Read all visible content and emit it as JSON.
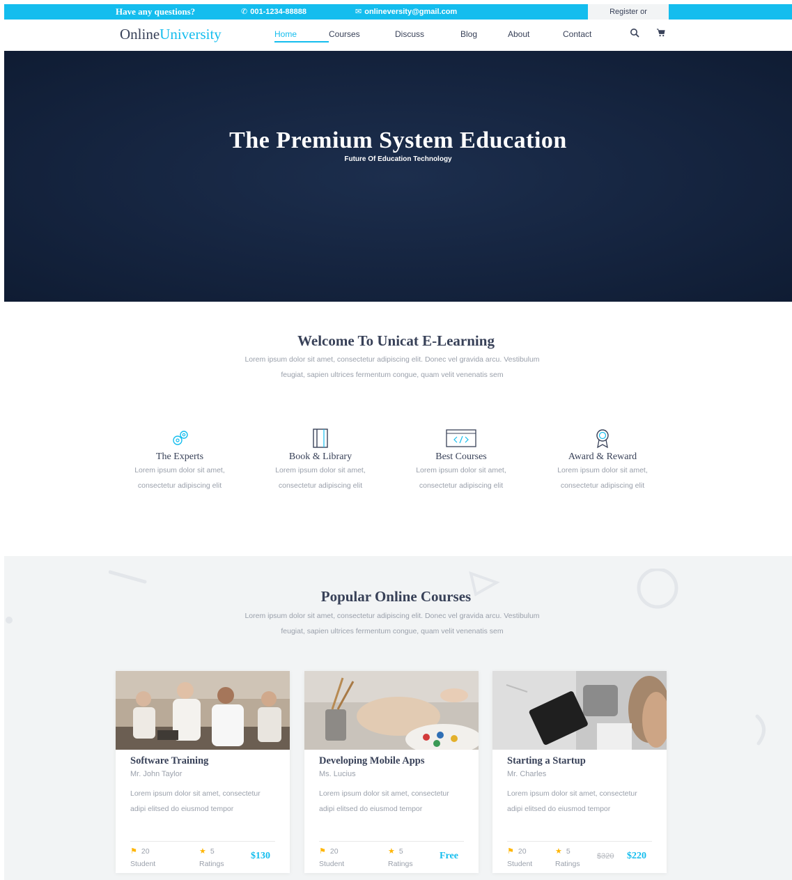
{
  "topbar": {
    "question": "Have any questions?",
    "phone": "001-1234-88888",
    "email": "onlineversity@gmail.com",
    "register": "Register or"
  },
  "nav": {
    "logo_main": "Online",
    "logo_accent": "University",
    "items": [
      "Home",
      "Courses",
      "Discuss",
      "Blog",
      "About",
      "Contact"
    ],
    "active": "Home",
    "icons": [
      "search-icon",
      "cart-icon"
    ]
  },
  "hero": {
    "title": "The Premium System Education",
    "subtitle": "Future Of Education Technology"
  },
  "welcome": {
    "title": "Welcome To Unicat E-Learning",
    "text": "Lorem ipsum dolor sit amet, consectetur adipiscing elit. Donec vel gravida arcu. Vestibulum feugiat, sapien ultrices fermentum congue, quam velit venenatis sem",
    "features": [
      {
        "icon": "gears-icon",
        "title": "The Experts",
        "text": "Lorem ipsum dolor sit amet, consectetur adipiscing elit"
      },
      {
        "icon": "book-icon",
        "title": "Book & Library",
        "text": "Lorem ipsum dolor sit amet, consectetur adipiscing elit"
      },
      {
        "icon": "code-window-icon",
        "title": "Best Courses",
        "text": "Lorem ipsum dolor sit amet, consectetur adipiscing elit"
      },
      {
        "icon": "award-icon",
        "title": "Award & Reward",
        "text": "Lorem ipsum dolor sit amet, consectetur adipiscing elit"
      }
    ]
  },
  "popular": {
    "title": "Popular Online Courses",
    "text": "Lorem ipsum dolor sit amet, consectetur adipiscing elit. Donec vel gravida arcu. Vestibulum feugiat, sapien ultrices fermentum congue, quam velit venenatis sem",
    "courses": [
      {
        "title": "Software Training",
        "author": "Mr. John Taylor",
        "text": "Lorem ipsum dolor sit amet, consectetur adipi elitsed do eiusmod tempor",
        "students": "20",
        "students_label": "Student",
        "ratings": "5",
        "ratings_label": "Ratings",
        "price": "$130",
        "old_price": ""
      },
      {
        "title": "Developing Mobile Apps",
        "author": "Ms. Lucius",
        "text": "Lorem ipsum dolor sit amet, consectetur adipi elitsed do eiusmod tempor",
        "students": "20",
        "students_label": "Student",
        "ratings": "5",
        "ratings_label": "Ratings",
        "price": "Free",
        "old_price": ""
      },
      {
        "title": "Starting a Startup",
        "author": "Mr. Charles",
        "text": "Lorem ipsum dolor sit amet, consectetur adipi elitsed do eiusmod tempor",
        "students": "20",
        "students_label": "Student",
        "ratings": "5",
        "ratings_label": "Ratings",
        "price": "$220",
        "old_price": "$320"
      }
    ]
  },
  "colors": {
    "accent": "#14bdee",
    "dark": "#384158",
    "hero_bg": "#15243f",
    "star": "#ffb606"
  }
}
